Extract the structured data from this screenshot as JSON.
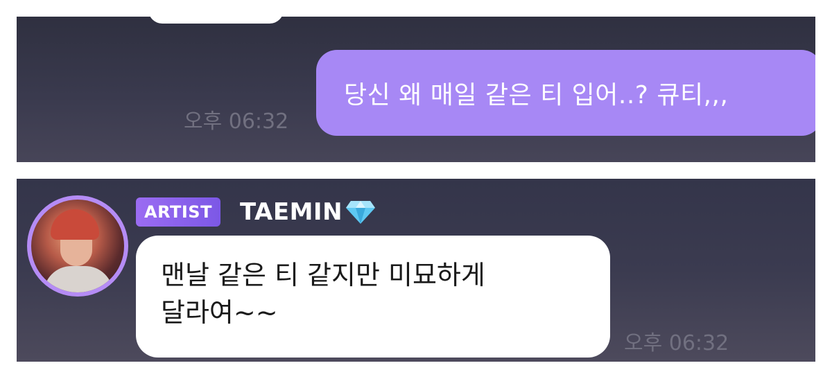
{
  "top_panel": {
    "sent_message": {
      "text": "당신 왜 매일 같은 티 입어..? 큐티,,,",
      "time": "오후 06:32"
    }
  },
  "bottom_panel": {
    "sender": {
      "badge": "ARTIST",
      "name": "TAEMIN",
      "name_icon": "diamond-icon"
    },
    "received_message": {
      "line1": "맨날 같은 티 같지만 미묘하게",
      "line2": "달라여~~",
      "time": "오후 06:32"
    }
  },
  "colors": {
    "sent_bubble": "#a788f5",
    "badge": "#8a60ee",
    "avatar_ring": "#b58cf5",
    "diamond": "#5ec8f2"
  }
}
